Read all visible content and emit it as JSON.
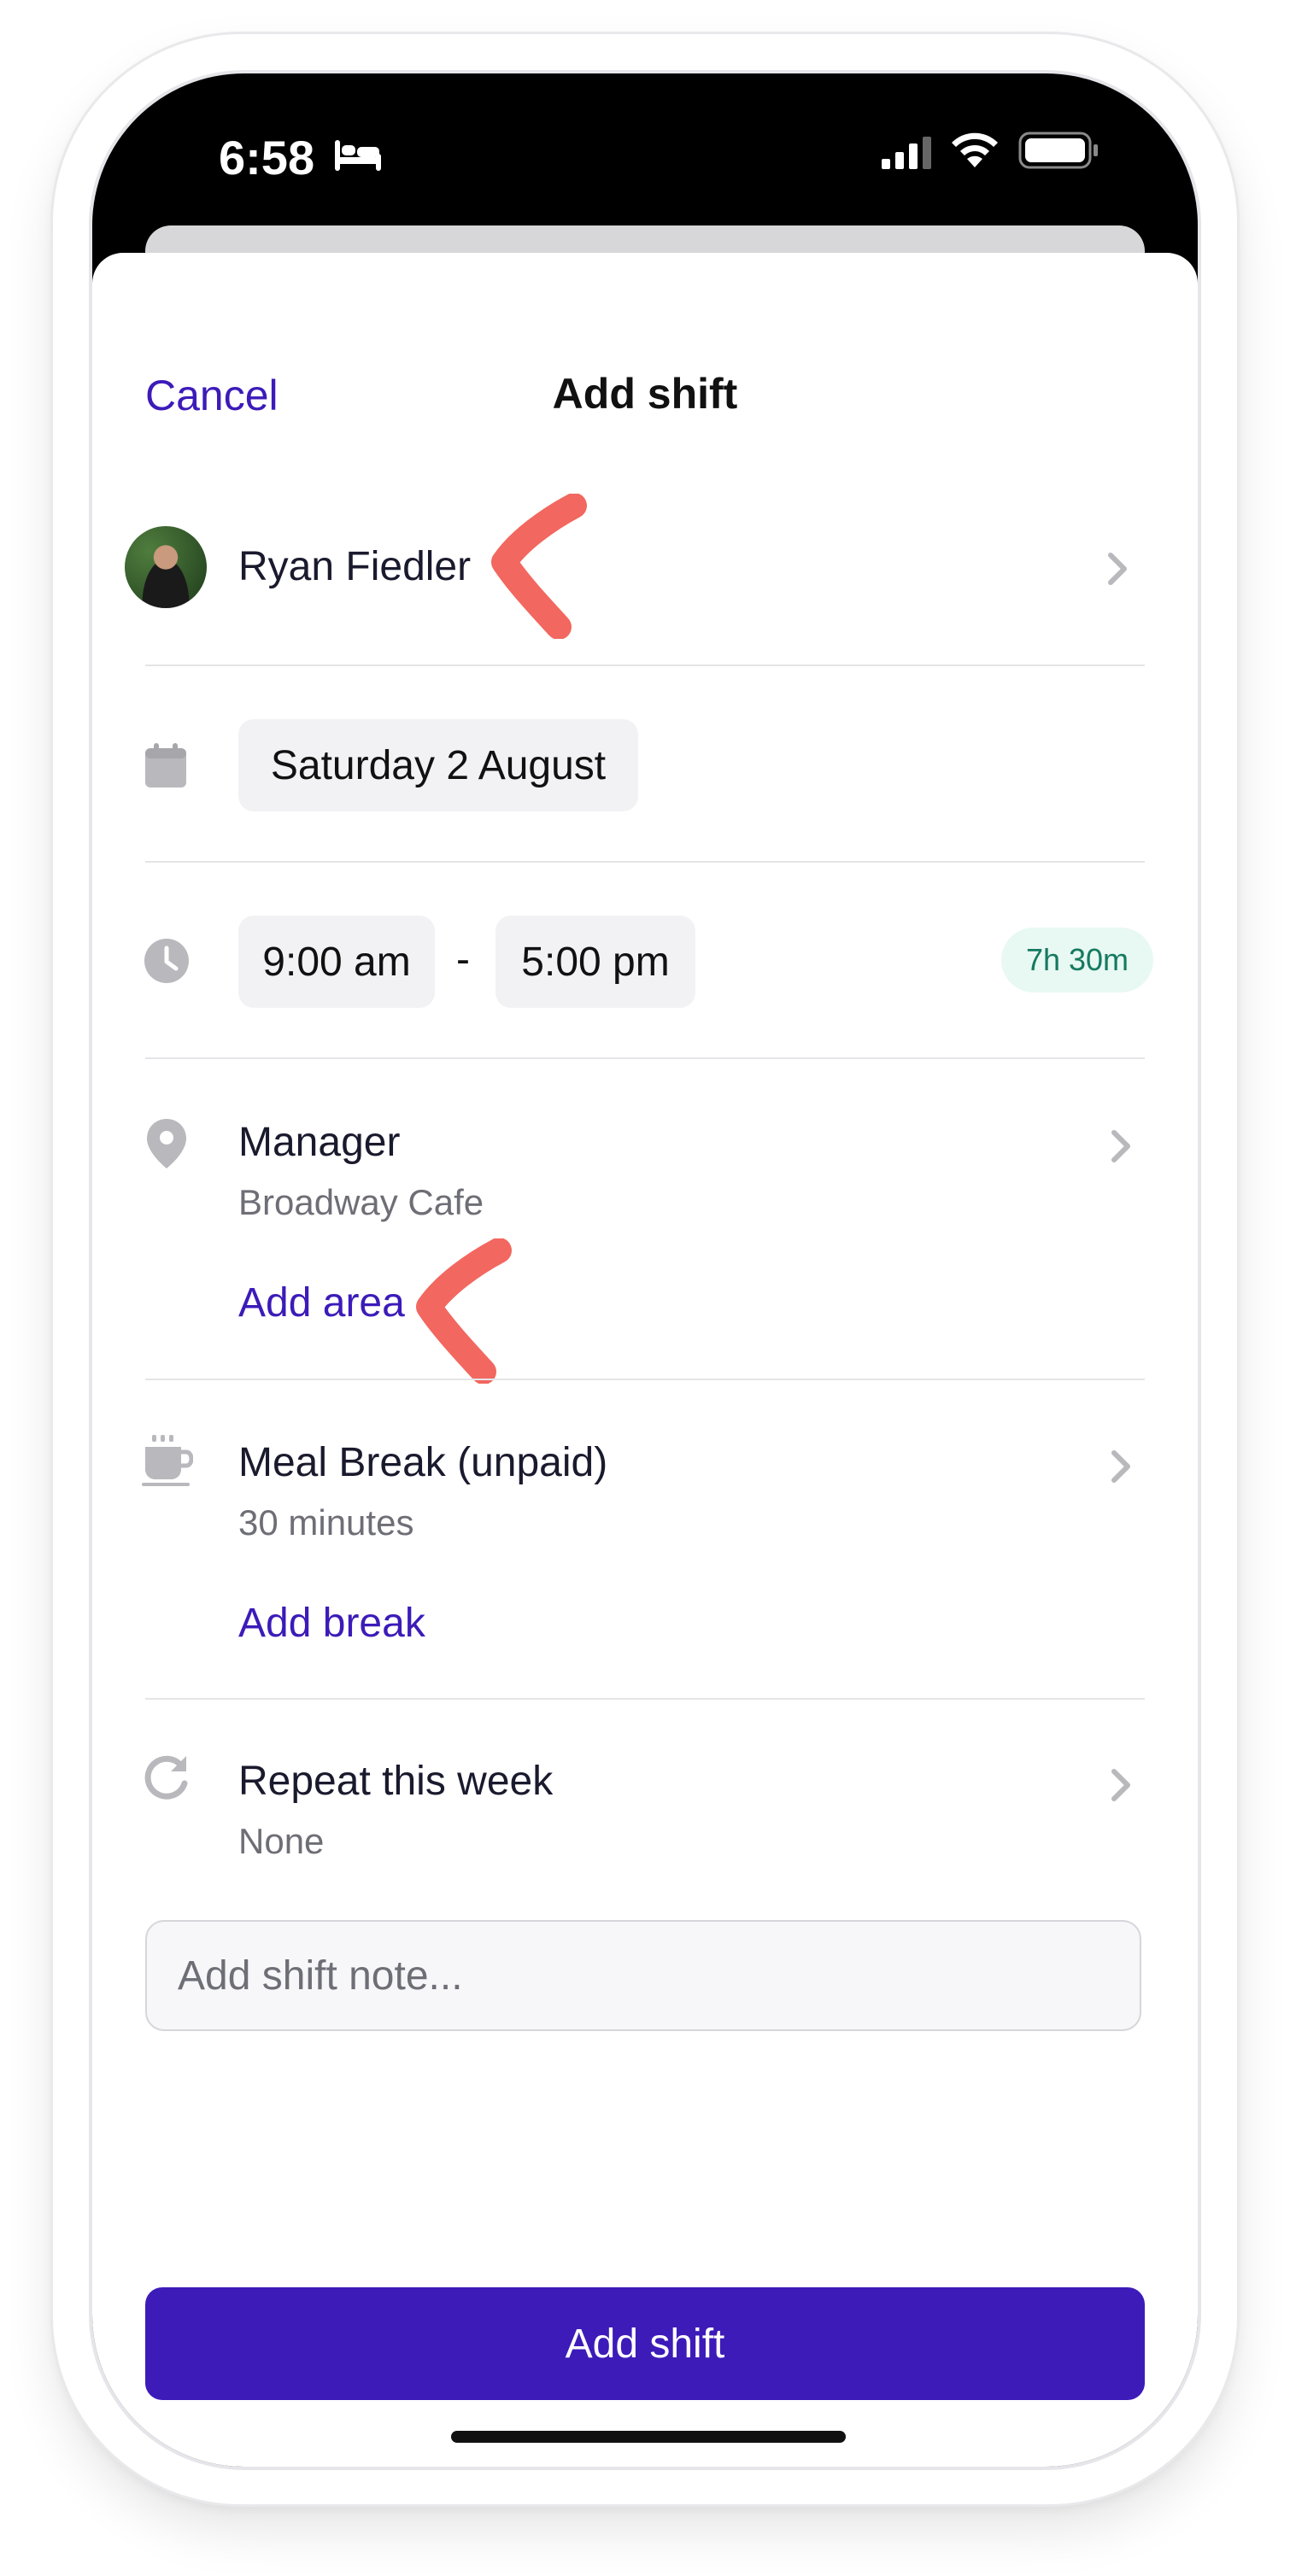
{
  "status_bar": {
    "time": "6:58"
  },
  "header": {
    "cancel_label": "Cancel",
    "title": "Add shift"
  },
  "employee": {
    "name": "Ryan Fiedler"
  },
  "date": {
    "value": "Saturday 2 August"
  },
  "time": {
    "start": "9:00 am",
    "separator": "-",
    "end": "5:00 pm",
    "duration": "7h 30m"
  },
  "role": {
    "name": "Manager",
    "location": "Broadway Cafe",
    "add_area_label": "Add area"
  },
  "break": {
    "name": "Meal Break (unpaid)",
    "duration": "30 minutes",
    "add_break_label": "Add break"
  },
  "repeat": {
    "label": "Repeat this week",
    "value": "None"
  },
  "note": {
    "placeholder": "Add shift note..."
  },
  "primary_button": {
    "label": "Add shift"
  },
  "colors": {
    "accent": "#3c1bb9",
    "annotation": "#f2675f",
    "badge_bg": "#e8f8f3",
    "badge_text": "#157a60"
  }
}
